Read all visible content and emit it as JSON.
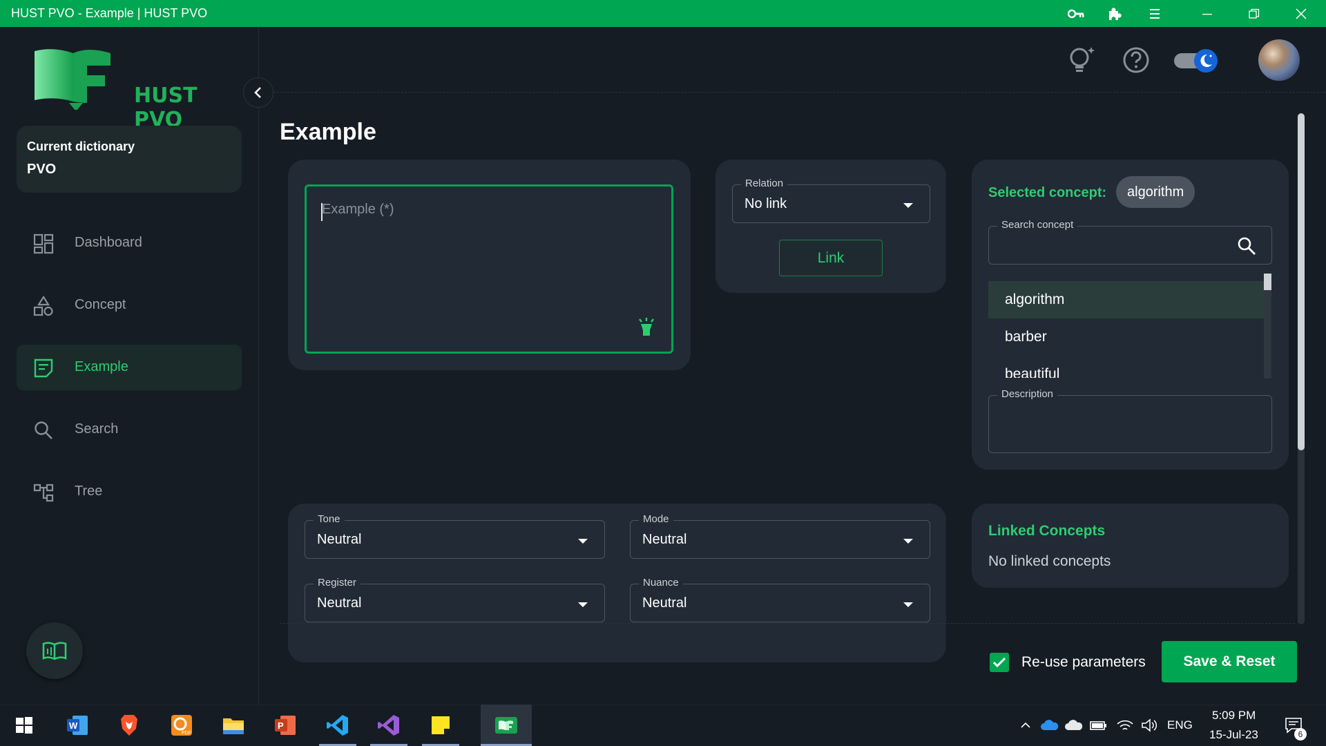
{
  "window": {
    "title": "HUST PVO - Example | HUST PVO"
  },
  "sidebar": {
    "logo_text": "HUST PVO",
    "dictionary_label": "Current dictionary",
    "dictionary_value": "PVO",
    "items": [
      {
        "label": "Dashboard",
        "icon": "dashboard-icon"
      },
      {
        "label": "Concept",
        "icon": "shapes-icon"
      },
      {
        "label": "Example",
        "icon": "note-icon",
        "active": true
      },
      {
        "label": "Search",
        "icon": "search-icon"
      },
      {
        "label": "Tree",
        "icon": "tree-icon"
      }
    ]
  },
  "page": {
    "title": "Example"
  },
  "example_input": {
    "placeholder": "Example (*)",
    "value": ""
  },
  "relation": {
    "label": "Relation",
    "value": "No link",
    "link_button": "Link"
  },
  "concept_panel": {
    "selected_label": "Selected concept:",
    "selected_value": "algorithm",
    "search_label": "Search concept",
    "search_value": "",
    "items": [
      "algorithm",
      "barber",
      "beautiful"
    ],
    "description_label": "Description",
    "description_value": ""
  },
  "parameters": {
    "tone_label": "Tone",
    "tone_value": "Neutral",
    "mode_label": "Mode",
    "mode_value": "Neutral",
    "register_label": "Register",
    "register_value": "Neutral",
    "nuance_label": "Nuance",
    "nuance_value": "Neutral"
  },
  "linked": {
    "title": "Linked Concepts",
    "empty_text": "No linked concepts"
  },
  "footer": {
    "reuse_label": "Re-use parameters",
    "reuse_checked": true,
    "save_button": "Save & Reset"
  },
  "taskbar": {
    "language": "ENG",
    "time": "5:09 PM",
    "date": "15-Jul-23",
    "notification_count": "6"
  },
  "colors": {
    "accent": "#00a651",
    "accent_text": "#2ecc71",
    "background": "#151c24",
    "card": "#212a35"
  }
}
